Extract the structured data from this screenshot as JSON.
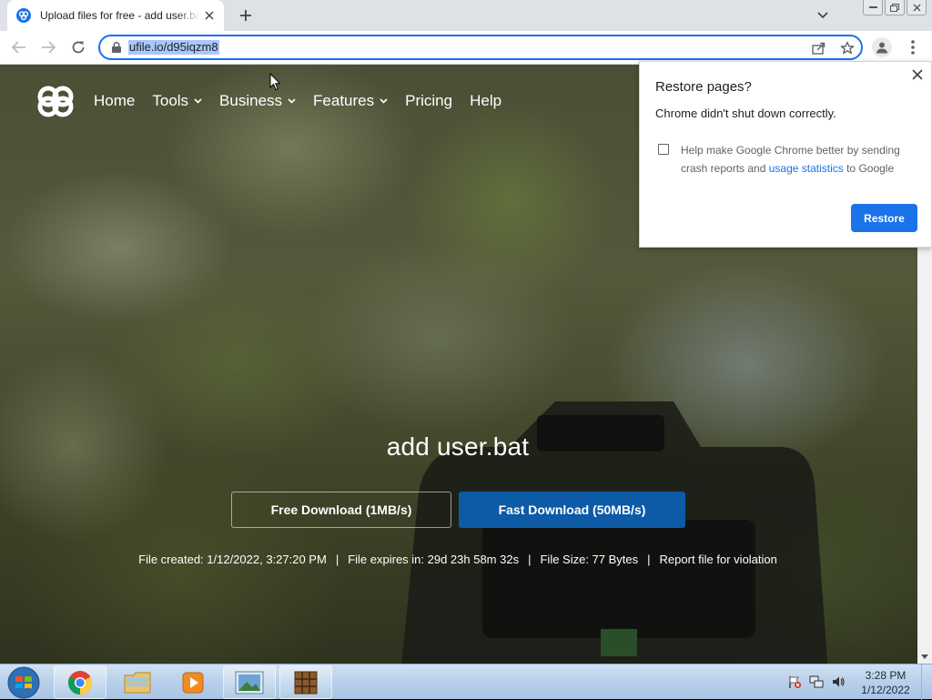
{
  "browser": {
    "tab_title": "Upload files for free - add user.bat - ufile.io",
    "url": "ufile.io/d95iqzm8"
  },
  "site": {
    "nav": {
      "home": "Home",
      "tools": "Tools",
      "business": "Business",
      "features": "Features",
      "pricing": "Pricing",
      "help": "Help"
    },
    "file_name": "add user.bat",
    "free_download": "Free Download (1MB/s)",
    "fast_download": "Fast Download (50MB/s)",
    "meta": {
      "created": "File created: 1/12/2022, 3:27:20 PM",
      "expires": "File expires in: 29d 23h 58m 32s",
      "size": "File Size: 77 Bytes",
      "report": "Report file for violation",
      "separator": "|"
    },
    "accent_color": "#0d5aa7"
  },
  "restore_popup": {
    "title": "Restore pages?",
    "subtitle": "Chrome didn't shut down correctly.",
    "checkbox_text_before": "Help make Google Chrome better by sending crash reports and ",
    "checkbox_link": "usage statistics",
    "checkbox_text_after": " to Google",
    "checkbox_checked": false,
    "restore_button": "Restore"
  },
  "taskbar": {
    "time": "3:28 PM",
    "date": "1/12/2022",
    "apps": [
      "windows-start-icon",
      "chrome-icon",
      "file-explorer-icon",
      "media-player-icon",
      "photo-viewer-icon",
      "archive-app-icon"
    ]
  }
}
